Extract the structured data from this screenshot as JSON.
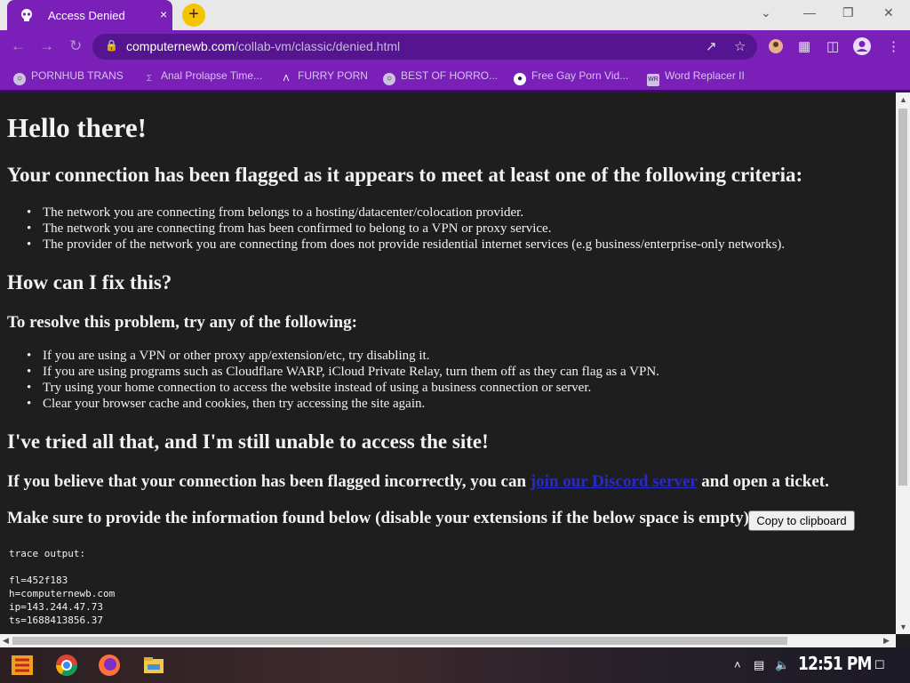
{
  "browser": {
    "tab_title": "Access Denied",
    "tab_close": "×",
    "new_tab": "+",
    "url_host": "computernewb.com",
    "url_path": "/collab-vm/classic/denied.html",
    "accent_color": "#7a1fb8"
  },
  "window_controls": {
    "minimize": "—",
    "restore": "❐",
    "close": "✕",
    "dropdown": "⌄"
  },
  "bookmarks": [
    {
      "label": "PORNHUB TRANS",
      "icon": "globe-icon"
    },
    {
      "label": "Anal Prolapse Time...",
      "icon": "bracket-icon"
    },
    {
      "label": "FURRY PORN",
      "icon": "arrow-up-icon"
    },
    {
      "label": "BEST OF HORRO...",
      "icon": "globe-icon"
    },
    {
      "label": "Free Gay Porn Vid...",
      "icon": "skull-icon"
    },
    {
      "label": "Word Replacer II",
      "icon": "wr-icon"
    }
  ],
  "content": {
    "greeting": "Hello there!",
    "flagged_heading": "Your connection has been flagged as it appears to meet at least one of the following criteria:",
    "criteria": [
      "The network you are connecting from belongs to a hosting/datacenter/colocation provider.",
      "The network you are connecting from has been confirmed to belong to a VPN or proxy service.",
      "The provider of the network you are connecting from does not provide residential internet services (e.g business/enterprise-only networks)."
    ],
    "fix_heading": "How can I fix this?",
    "resolve_heading": "To resolve this problem, try any of the following:",
    "fixes": [
      "If you are using a VPN or other proxy app/extension/etc, try disabling it.",
      "If you are using programs such as Cloudflare WARP, iCloud Private Relay, turn them off as they can flag as a VPN.",
      "Try using your home connection to access the website instead of using a business connection or server.",
      "Clear your browser cache and cookies, then try accessing the site again."
    ],
    "still_heading": "I've tried all that, and I'm still unable to access the site!",
    "incorrect_before": "If you believe that your connection has been flagged incorrectly, you can",
    "discord_link": "join our Discord server",
    "incorrect_after": "and open a ticket.",
    "provide_info": "Make sure to provide the information found below (disable your extensions if the below space is empty):",
    "copy_button": "Copy to clipboard",
    "trace_label": "trace output:",
    "trace_lines": [
      "fl=452f183",
      "h=computernewb.com",
      "ip=143.244.47.73",
      "ts=1688413856.37"
    ]
  },
  "taskbar": {
    "clock": "12:51 PM"
  }
}
